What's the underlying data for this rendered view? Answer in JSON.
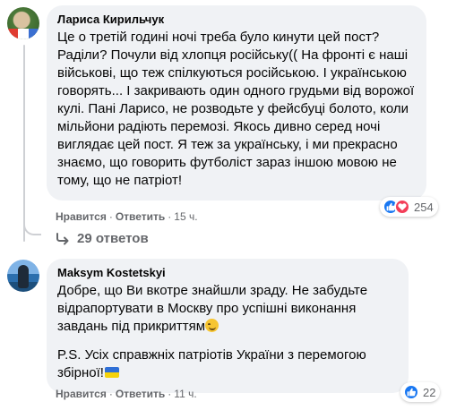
{
  "comments": [
    {
      "author": "Лариса Кирильчук",
      "text": "Це о третій годині ночі треба було кинути цей пост? Раділи? Почули від хлопця російську(( На фронті є наші військові, що теж спілкуються російською. І українською говорять... І закривають один одного грудьми від ворожої кулі. Пані Ларисо, не розводьте у фейсбуці болото, коли мільйони радіють перемозі. Якось дивно серед ночі виглядає цей пост. Я теж за українську, і ми прекрасно знаємо, що говорить футболіст зараз іншою мовою не тому, що не патріот!",
      "like_label": "Нравится",
      "reply_label": "Ответить",
      "time": "15 ч.",
      "reactions": [
        "like-icon",
        "love-icon"
      ],
      "reaction_count": "254",
      "replies_label": "29 ответов"
    },
    {
      "author": "Maksym Kostetskyi",
      "text": "Добре, що Ви вкотре знайшли зраду. Не забудьте відрапортувати в Москву про успішні виконання завдань під прикриттям",
      "ps_text": "P.S. Усіх справжніх патріотів України з перемогою збірної!",
      "like_label": "Нравится",
      "reply_label": "Ответить",
      "time": "11 ч.",
      "reactions": [
        "like-icon"
      ],
      "reaction_count": "22"
    }
  ],
  "separator": "·",
  "colors": {
    "bubble": "#f0f2f5",
    "secondary_text": "#65676b",
    "like_blue": "#1877f2",
    "love_red": "#f33e58"
  }
}
